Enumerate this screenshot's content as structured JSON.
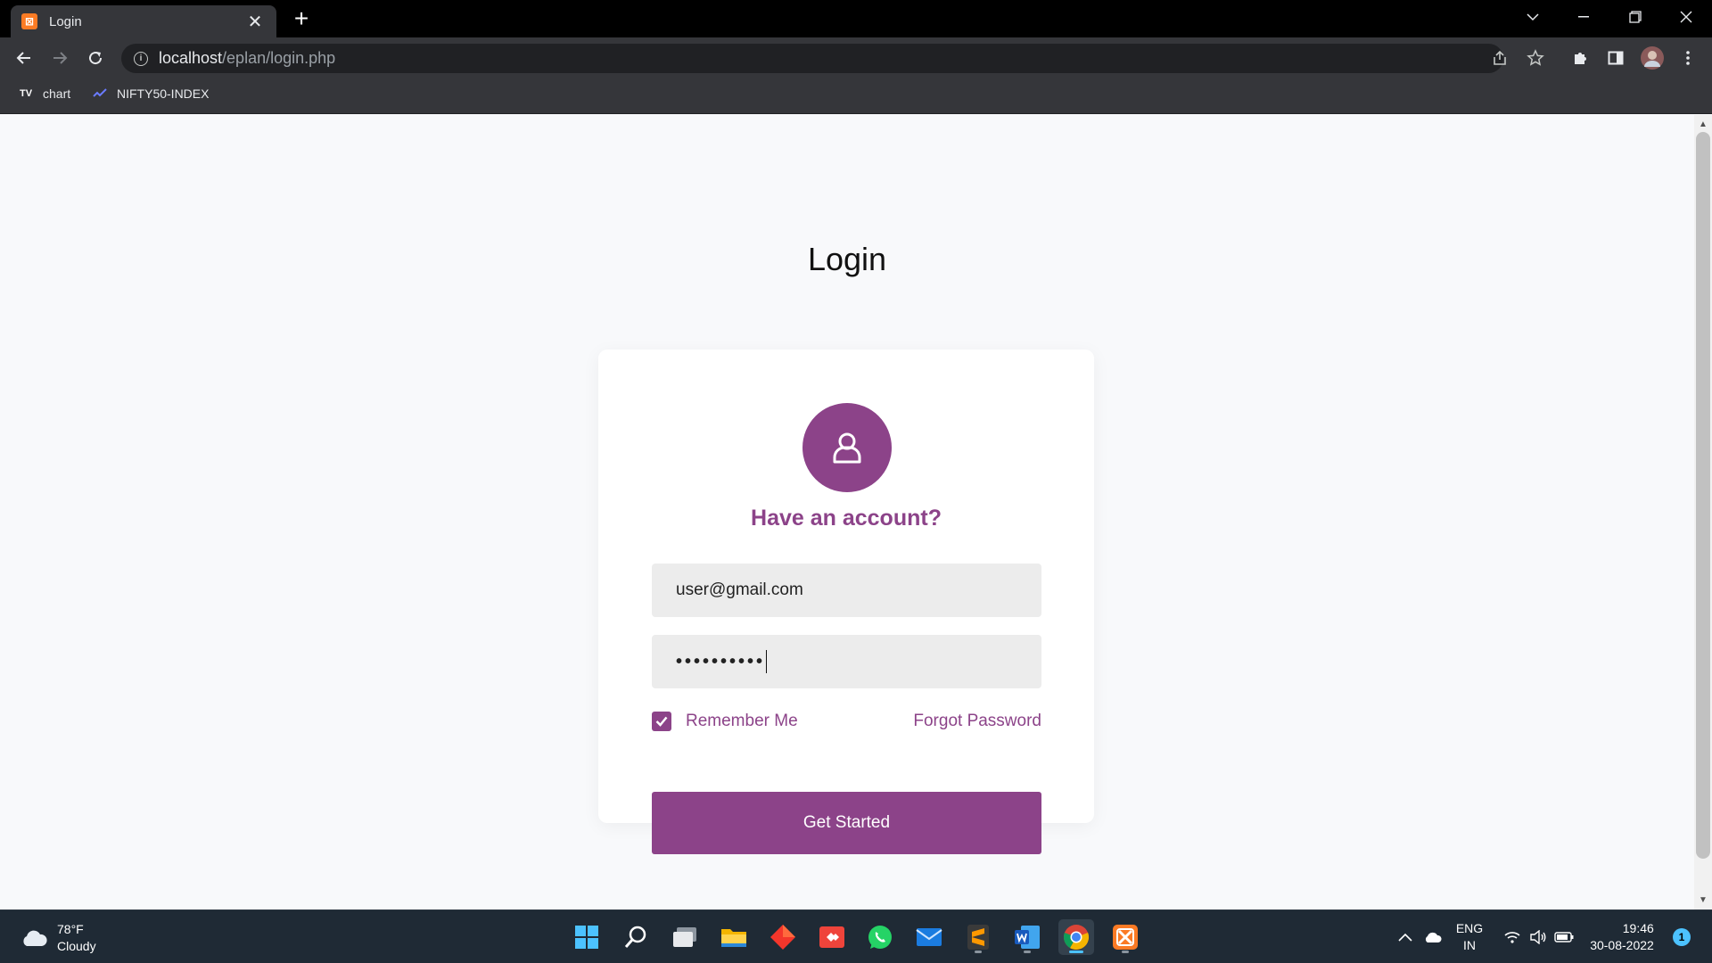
{
  "browser": {
    "tab": {
      "title": "Login",
      "close": "✕"
    },
    "new_tab": "+",
    "address": {
      "host": "localhost",
      "path": "/eplan/login.php"
    },
    "bookmarks": [
      {
        "label": "chart",
        "icon": "tradingview-icon"
      },
      {
        "label": "NIFTY50-INDEX",
        "icon": "chart-bookmark-icon"
      }
    ]
  },
  "page": {
    "title": "Login",
    "heading": "Have an account?",
    "email_value": "user@gmail.com",
    "password_mask": "••••••••••",
    "remember_label": "Remember Me",
    "remember_checked": true,
    "forgot_label": "Forgot Password",
    "submit_label": "Get Started"
  },
  "colors": {
    "accent": "#8c4389",
    "field_bg": "#ececec",
    "page_bg": "#f8f9fb"
  },
  "taskbar": {
    "weather": {
      "temp": "78°F",
      "condition": "Cloudy"
    },
    "apps": [
      "start-icon",
      "search-icon",
      "task-view-icon",
      "file-explorer-icon",
      "app-diamond-icon",
      "anydesk-icon",
      "whatsapp-icon",
      "mail-icon",
      "sublime-text-icon",
      "word-icon",
      "chrome-icon",
      "xampp-icon"
    ],
    "language": {
      "line1": "ENG",
      "line2": "IN"
    },
    "clock": {
      "time": "19:46",
      "date": "30-08-2022"
    },
    "notifications": "1"
  }
}
